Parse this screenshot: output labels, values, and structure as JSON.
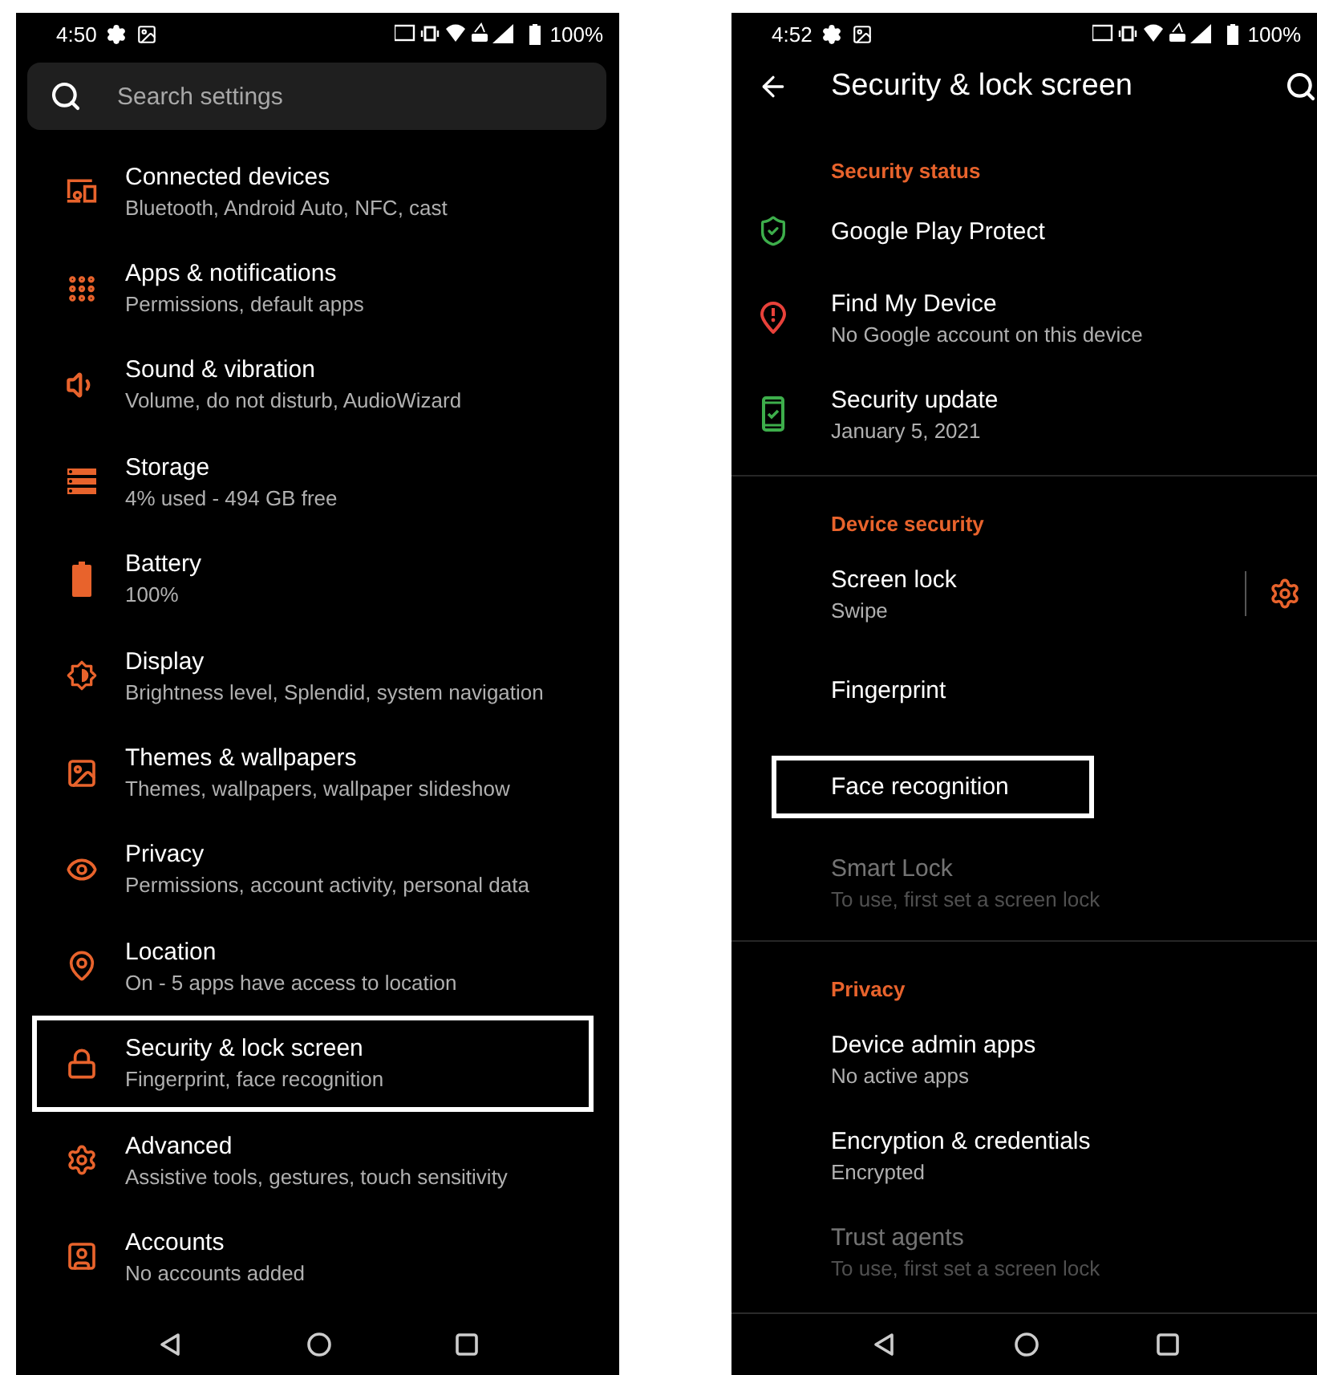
{
  "settings_screen": {
    "status_bar": {
      "time": "4:50",
      "battery": "100%"
    },
    "search": {
      "placeholder": "Search settings"
    },
    "items": [
      {
        "title": "Connected devices",
        "subtitle": "Bluetooth, Android Auto, NFC, cast",
        "highlighted": false
      },
      {
        "title": "Apps & notifications",
        "subtitle": "Permissions, default apps",
        "highlighted": false
      },
      {
        "title": "Sound & vibration",
        "subtitle": "Volume, do not disturb, AudioWizard",
        "highlighted": false
      },
      {
        "title": "Storage",
        "subtitle": "4% used - 494 GB free",
        "highlighted": false
      },
      {
        "title": "Battery",
        "subtitle": "100%",
        "highlighted": false
      },
      {
        "title": "Display",
        "subtitle": "Brightness level, Splendid, system navigation",
        "highlighted": false
      },
      {
        "title": "Themes & wallpapers",
        "subtitle": "Themes, wallpapers, wallpaper slideshow",
        "highlighted": false
      },
      {
        "title": "Privacy",
        "subtitle": "Permissions, account activity, personal data",
        "highlighted": false
      },
      {
        "title": "Location",
        "subtitle": "On - 5 apps have access to location",
        "highlighted": false
      },
      {
        "title": "Security & lock screen",
        "subtitle": "Fingerprint, face recognition",
        "highlighted": true
      },
      {
        "title": "Advanced",
        "subtitle": "Assistive tools, gestures, touch sensitivity",
        "highlighted": false
      },
      {
        "title": "Accounts",
        "subtitle": "No accounts added",
        "highlighted": false
      }
    ]
  },
  "security_screen": {
    "status_bar": {
      "time": "4:52",
      "battery": "100%"
    },
    "app_bar": {
      "title": "Security & lock screen"
    },
    "sections": [
      {
        "header": "Security status",
        "items": [
          {
            "kind": "status",
            "title": "Google Play Protect",
            "color": "#3dae4b",
            "highlighted": false,
            "disabled": false
          },
          {
            "kind": "status",
            "title": "Find My Device",
            "subtitle": "No Google account on this device",
            "color": "#e8413a",
            "highlighted": false,
            "disabled": false
          },
          {
            "kind": "status",
            "title": "Security update",
            "subtitle": "January 5, 2021",
            "color": "#3dae4b",
            "highlighted": false,
            "disabled": false
          }
        ]
      },
      {
        "header": "Device security",
        "items": [
          {
            "kind": "with_settings",
            "title": "Screen lock",
            "subtitle": "Swipe",
            "highlighted": false,
            "disabled": false
          },
          {
            "kind": "plain",
            "title": "Fingerprint",
            "highlighted": false,
            "disabled": false
          },
          {
            "kind": "plain",
            "title": "Face recognition",
            "highlighted": true,
            "disabled": false
          },
          {
            "kind": "plain",
            "title": "Smart Lock",
            "subtitle": "To use, first set a screen lock",
            "highlighted": false,
            "disabled": true
          }
        ]
      },
      {
        "header": "Privacy",
        "items": [
          {
            "kind": "plain",
            "title": "Device admin apps",
            "subtitle": "No active apps",
            "highlighted": false,
            "disabled": false
          },
          {
            "kind": "plain",
            "title": "Encryption & credentials",
            "subtitle": "Encrypted",
            "highlighted": false,
            "disabled": false
          },
          {
            "kind": "plain",
            "title": "Trust agents",
            "subtitle": "To use, first set a screen lock",
            "highlighted": false,
            "disabled": true
          }
        ]
      }
    ]
  }
}
